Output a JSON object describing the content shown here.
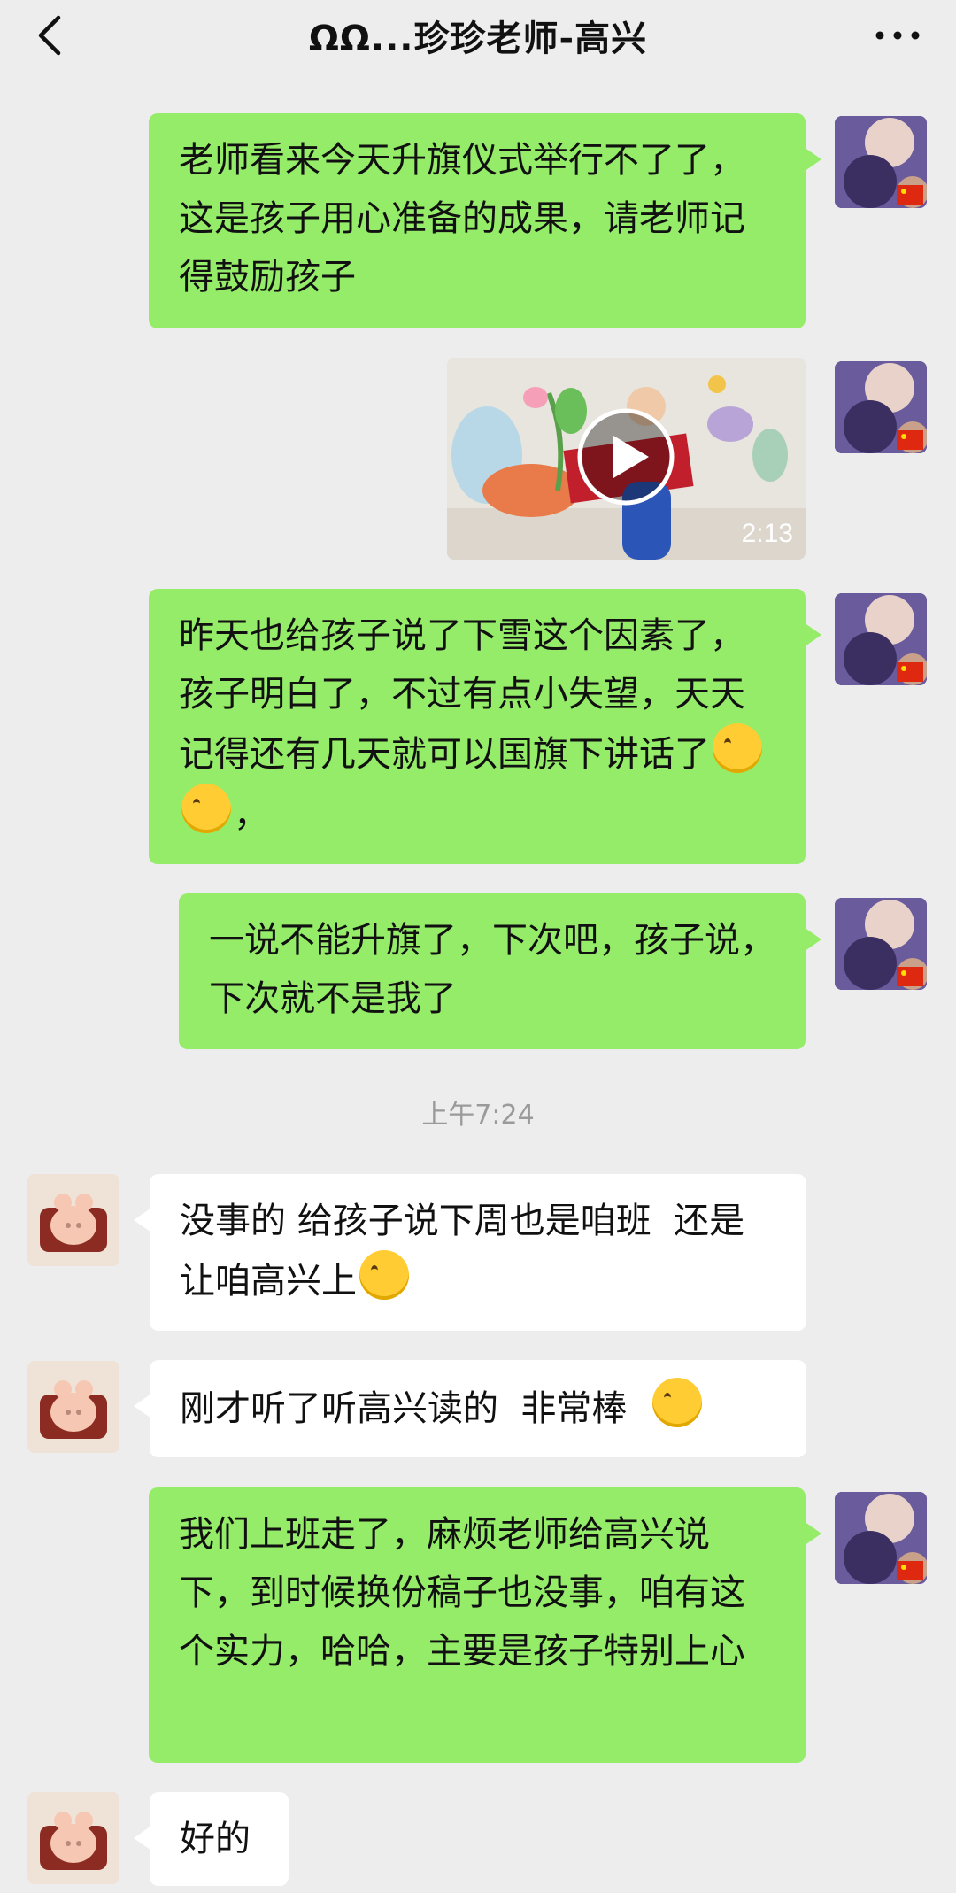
{
  "header": {
    "title": "ΩΩ...珍珍老师-高兴"
  },
  "messages": [
    {
      "text": "老师看来今天升旗仪式举行不了了，这是孩子用心准备的成果，请老师记得鼓励孩子"
    },
    {
      "duration": "2:13"
    },
    {
      "text": "昨天也给孩子说了下雪这个因素了，孩子明白了，不过有点小失望，天天记得还有几天就可以国旗下讲话了",
      "suffix": "，"
    },
    {
      "text": "一说不能升旗了，下次吧，孩子说，下次就不是我了"
    },
    {
      "timestamp": "上午7:24"
    },
    {
      "text": "没事的 给孩子说下周也是咱班  还是让咱高兴上"
    },
    {
      "text": "刚才听了听高兴读的  非常棒  "
    },
    {
      "text": "我们上班走了，麻烦老师给高兴说下，到时候换份稿子也没事，咱有这个实力，哈哈，主要是孩子特别上心"
    },
    {
      "text": "好的"
    }
  ],
  "colors": {
    "background": "#ededed",
    "bubble_self": "#95ec69",
    "bubble_other": "#ffffff"
  },
  "icons": [
    "back-arrow-icon",
    "more-icon",
    "play-icon",
    "grin-emoji-icon",
    "smile-emoji-icon"
  ]
}
